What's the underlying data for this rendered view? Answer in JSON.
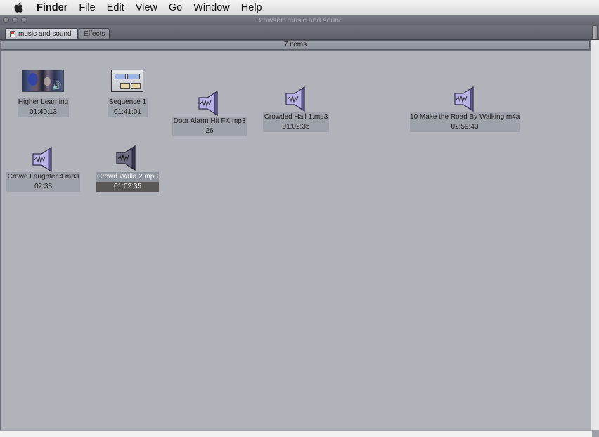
{
  "menubar": {
    "apple_icon": "apple-logo-icon",
    "items": [
      "Finder",
      "File",
      "Edit",
      "View",
      "Go",
      "Window",
      "Help"
    ]
  },
  "window": {
    "title": "Browser: music and sound",
    "tabs": [
      {
        "label": "music and sound",
        "active": true
      },
      {
        "label": "Effects",
        "active": false
      }
    ],
    "item_count": "7 items"
  },
  "items": [
    {
      "name": "Higher Learning",
      "duration": "01:40:13",
      "kind": "video-clip",
      "selected": false
    },
    {
      "name": "Sequence 1",
      "duration": "01:41:01",
      "kind": "sequence",
      "selected": false
    },
    {
      "name": "Door Alarm Hit FX.mp3",
      "duration": "26",
      "kind": "audio",
      "selected": false
    },
    {
      "name": "Crowded Hall 1.mp3",
      "duration": "01:02:35",
      "kind": "audio",
      "selected": false
    },
    {
      "name": "10 Make the Road By Walking.m4a",
      "duration": "02:59:43",
      "kind": "audio",
      "selected": false
    },
    {
      "name": "Crowd Laughter 4.mp3",
      "duration": "02:38",
      "kind": "audio",
      "selected": false
    },
    {
      "name": "Crowd Walla 2.mp3",
      "duration": "01:02:35",
      "kind": "audio",
      "selected": true
    }
  ],
  "colors": {
    "window_bg": "#6d7079",
    "content_bg": "#b0b3ba",
    "label_bg": "#9ea2aa",
    "selected_bg": "#5a5754"
  }
}
